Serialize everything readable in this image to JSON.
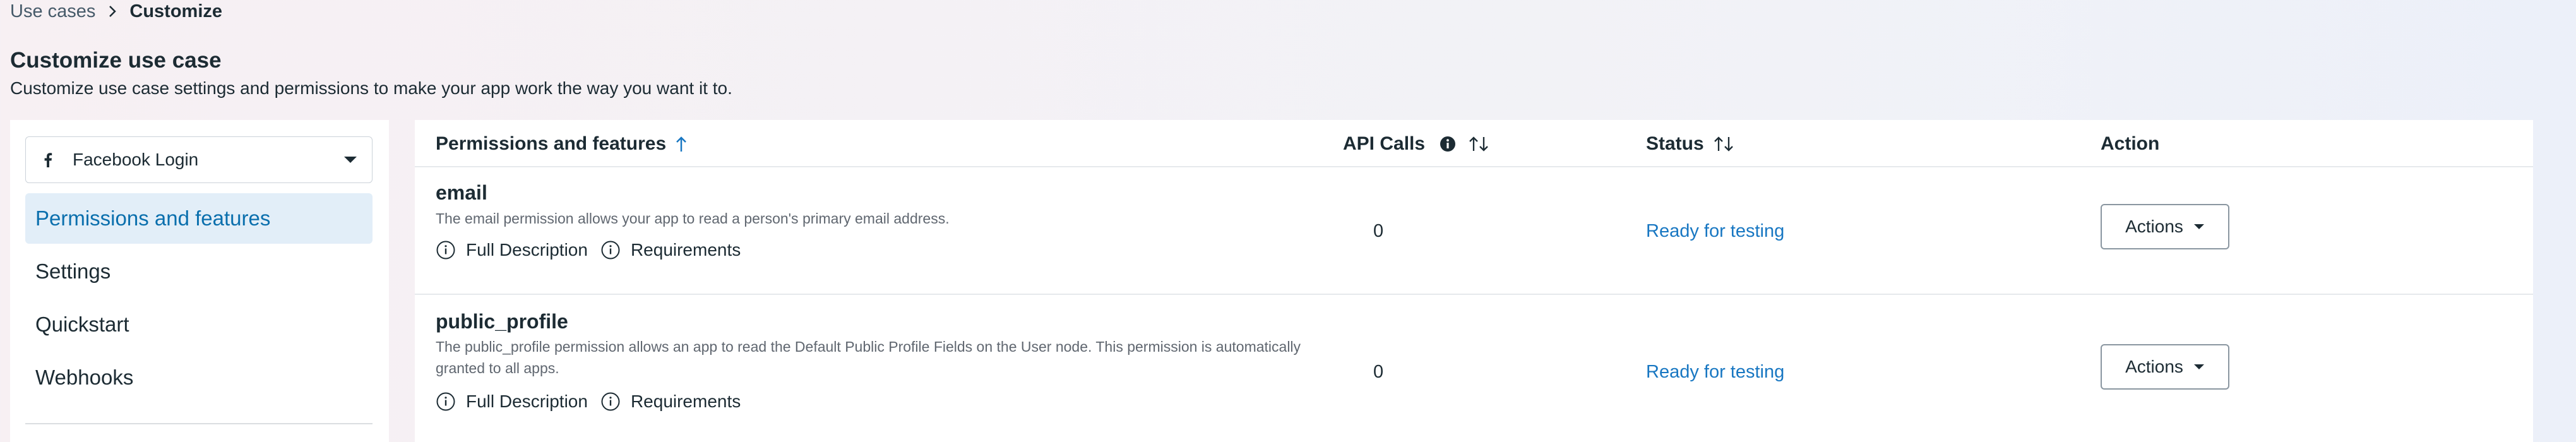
{
  "breadcrumb": {
    "parent": "Use cases",
    "current": "Customize"
  },
  "page": {
    "title": "Customize use case",
    "subtitle": "Customize use case settings and permissions to make your app work the way you want it to."
  },
  "sidebar": {
    "dropdown_value": "Facebook Login",
    "items": [
      {
        "label": "Permissions and features",
        "active": true
      },
      {
        "label": "Settings",
        "active": false
      },
      {
        "label": "Quickstart",
        "active": false
      },
      {
        "label": "Webhooks",
        "active": false
      }
    ]
  },
  "table": {
    "headers": {
      "permissions": "Permissions and features",
      "api_calls": "API Calls",
      "status": "Status",
      "action": "Action"
    },
    "rows": [
      {
        "name": "email",
        "description": "The email permission allows your app to read a person's primary email address.",
        "full_description_label": "Full Description",
        "requirements_label": "Requirements",
        "api_calls": "0",
        "status": "Ready for testing",
        "action_label": "Actions"
      },
      {
        "name": "public_profile",
        "description": "The public_profile permission allows an app to read the Default Public Profile Fields on the User node. This permission is automatically granted to all apps.",
        "full_description_label": "Full Description",
        "requirements_label": "Requirements",
        "api_calls": "0",
        "status": "Ready for testing",
        "action_label": "Actions"
      }
    ]
  },
  "colors": {
    "accent": "#1877c2",
    "active_bg": "#e2eef8",
    "active_text": "#0a6fad"
  },
  "icons": {
    "breadcrumb_separator": "chevron-right-icon",
    "dropdown_brand": "facebook-icon",
    "dropdown_caret": "caret-down-icon",
    "sort_asc": "arrow-up-icon",
    "sort_both": "sort-arrows-icon",
    "info": "info-icon",
    "circle_info": "circle-info-icon"
  }
}
